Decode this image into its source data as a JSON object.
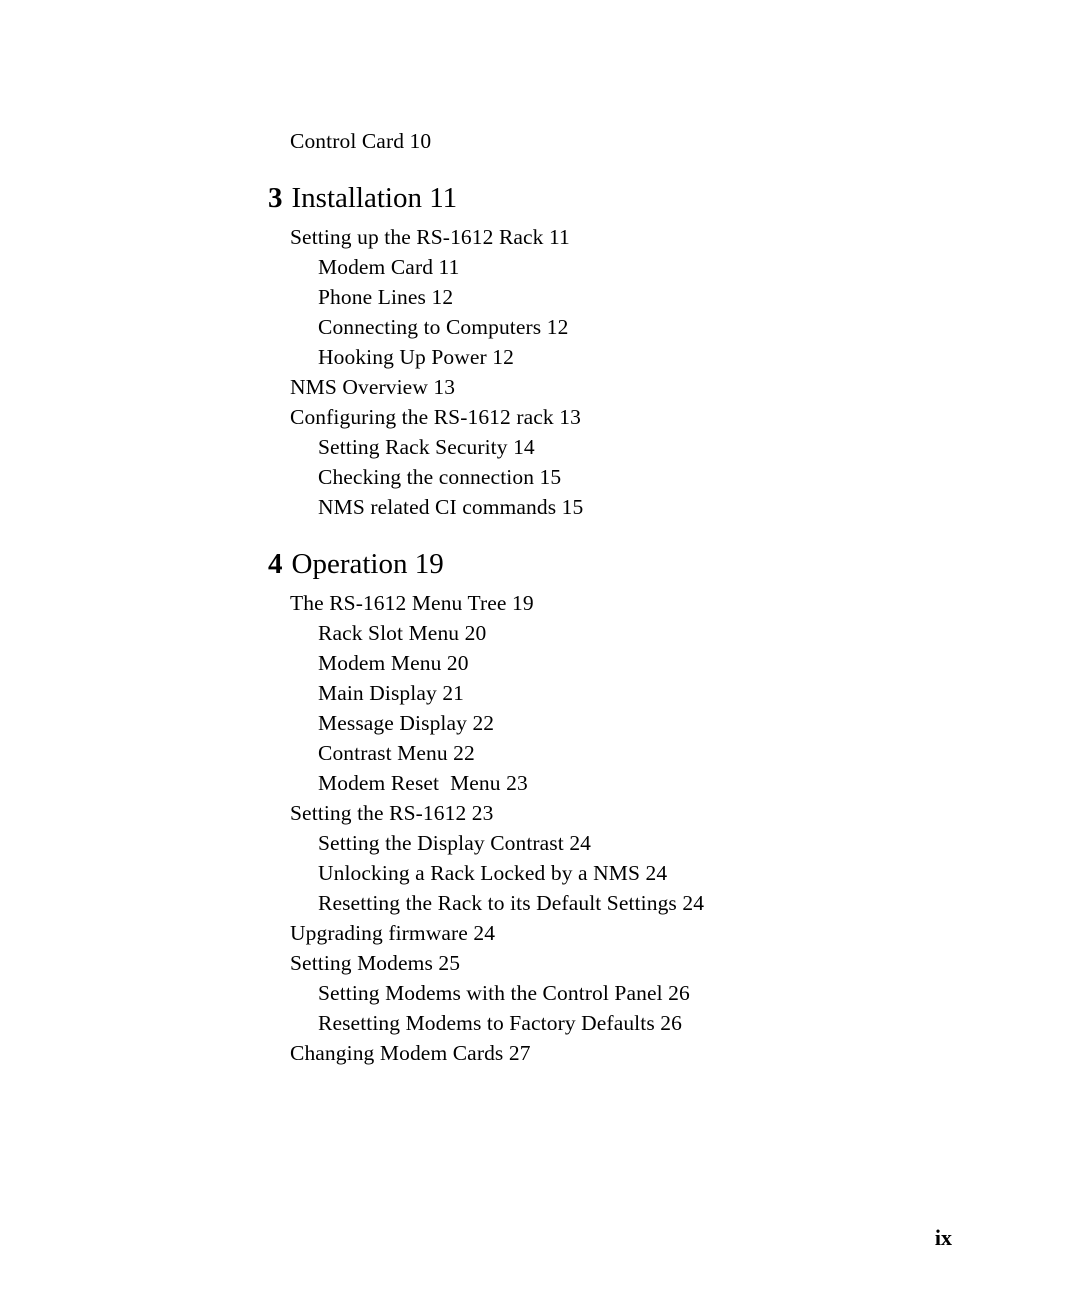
{
  "document": {
    "type": "table-of-contents",
    "page_number": "ix",
    "background_color": "#ffffff",
    "text_color": "#000000"
  },
  "toc": {
    "blocks": [
      {
        "kind": "entries",
        "entries": [
          {
            "level": 1,
            "text": "Control Card 10"
          }
        ]
      },
      {
        "kind": "chapter",
        "number": "3",
        "title": "Installation 11"
      },
      {
        "kind": "entries",
        "entries": [
          {
            "level": 1,
            "text": "Setting up the RS-1612 Rack 11"
          },
          {
            "level": 2,
            "text": "Modem Card 11"
          },
          {
            "level": 2,
            "text": "Phone Lines 12"
          },
          {
            "level": 2,
            "text": "Connecting to Computers 12"
          },
          {
            "level": 2,
            "text": "Hooking Up Power 12"
          },
          {
            "level": 1,
            "text": "NMS Overview 13"
          },
          {
            "level": 1,
            "text": "Configuring the RS-1612 rack 13"
          },
          {
            "level": 2,
            "text": "Setting Rack Security 14"
          },
          {
            "level": 2,
            "text": "Checking the connection 15"
          },
          {
            "level": 2,
            "text": "NMS related CI commands 15"
          }
        ]
      },
      {
        "kind": "chapter",
        "number": "4",
        "title": "Operation 19"
      },
      {
        "kind": "entries",
        "entries": [
          {
            "level": 1,
            "text": "The RS-1612 Menu Tree 19"
          },
          {
            "level": 2,
            "text": "Rack Slot Menu 20"
          },
          {
            "level": 2,
            "text": "Modem Menu 20"
          },
          {
            "level": 2,
            "text": "Main Display 21"
          },
          {
            "level": 2,
            "text": "Message Display 22"
          },
          {
            "level": 2,
            "text": "Contrast Menu 22"
          },
          {
            "level": 2,
            "text": "Modem Reset  Menu 23"
          },
          {
            "level": 1,
            "text": "Setting the RS-1612 23"
          },
          {
            "level": 2,
            "text": "Setting the Display Contrast 24"
          },
          {
            "level": 2,
            "text": "Unlocking a Rack Locked by a NMS 24"
          },
          {
            "level": 2,
            "text": "Resetting the Rack to its Default Settings 24"
          },
          {
            "level": 1,
            "text": "Upgrading firmware 24"
          },
          {
            "level": 1,
            "text": "Setting Modems 25"
          },
          {
            "level": 2,
            "text": "Setting Modems with the Control Panel 26"
          },
          {
            "level": 2,
            "text": "Resetting Modems to Factory Defaults 26"
          },
          {
            "level": 1,
            "text": "Changing Modem Cards 27"
          }
        ]
      }
    ]
  }
}
